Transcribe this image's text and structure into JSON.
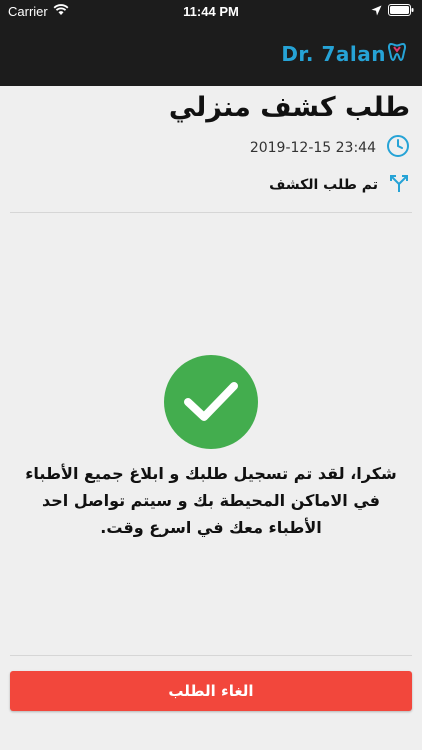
{
  "status_bar": {
    "carrier": "Carrier",
    "time": "11:44 PM"
  },
  "header": {
    "logo_text": "Dr. 7alan"
  },
  "request": {
    "title": "طلب كشف منزلي",
    "datetime": "2019-12-15 23:44",
    "status": "تم طلب الكشف"
  },
  "confirmation": {
    "message": "شكرا، لقد تم تسجيل  طلبك و ابلاغ جميع الأطباء في الاماكن المحيطة بك و سيتم تواصل احد الأطباء معك في اسرع وقت."
  },
  "actions": {
    "cancel_label": "الغاء الطلب"
  },
  "colors": {
    "accent": "#26a3d6",
    "success": "#43ad4e",
    "danger": "#f2473c",
    "nav_bg": "#1c1c1c"
  }
}
